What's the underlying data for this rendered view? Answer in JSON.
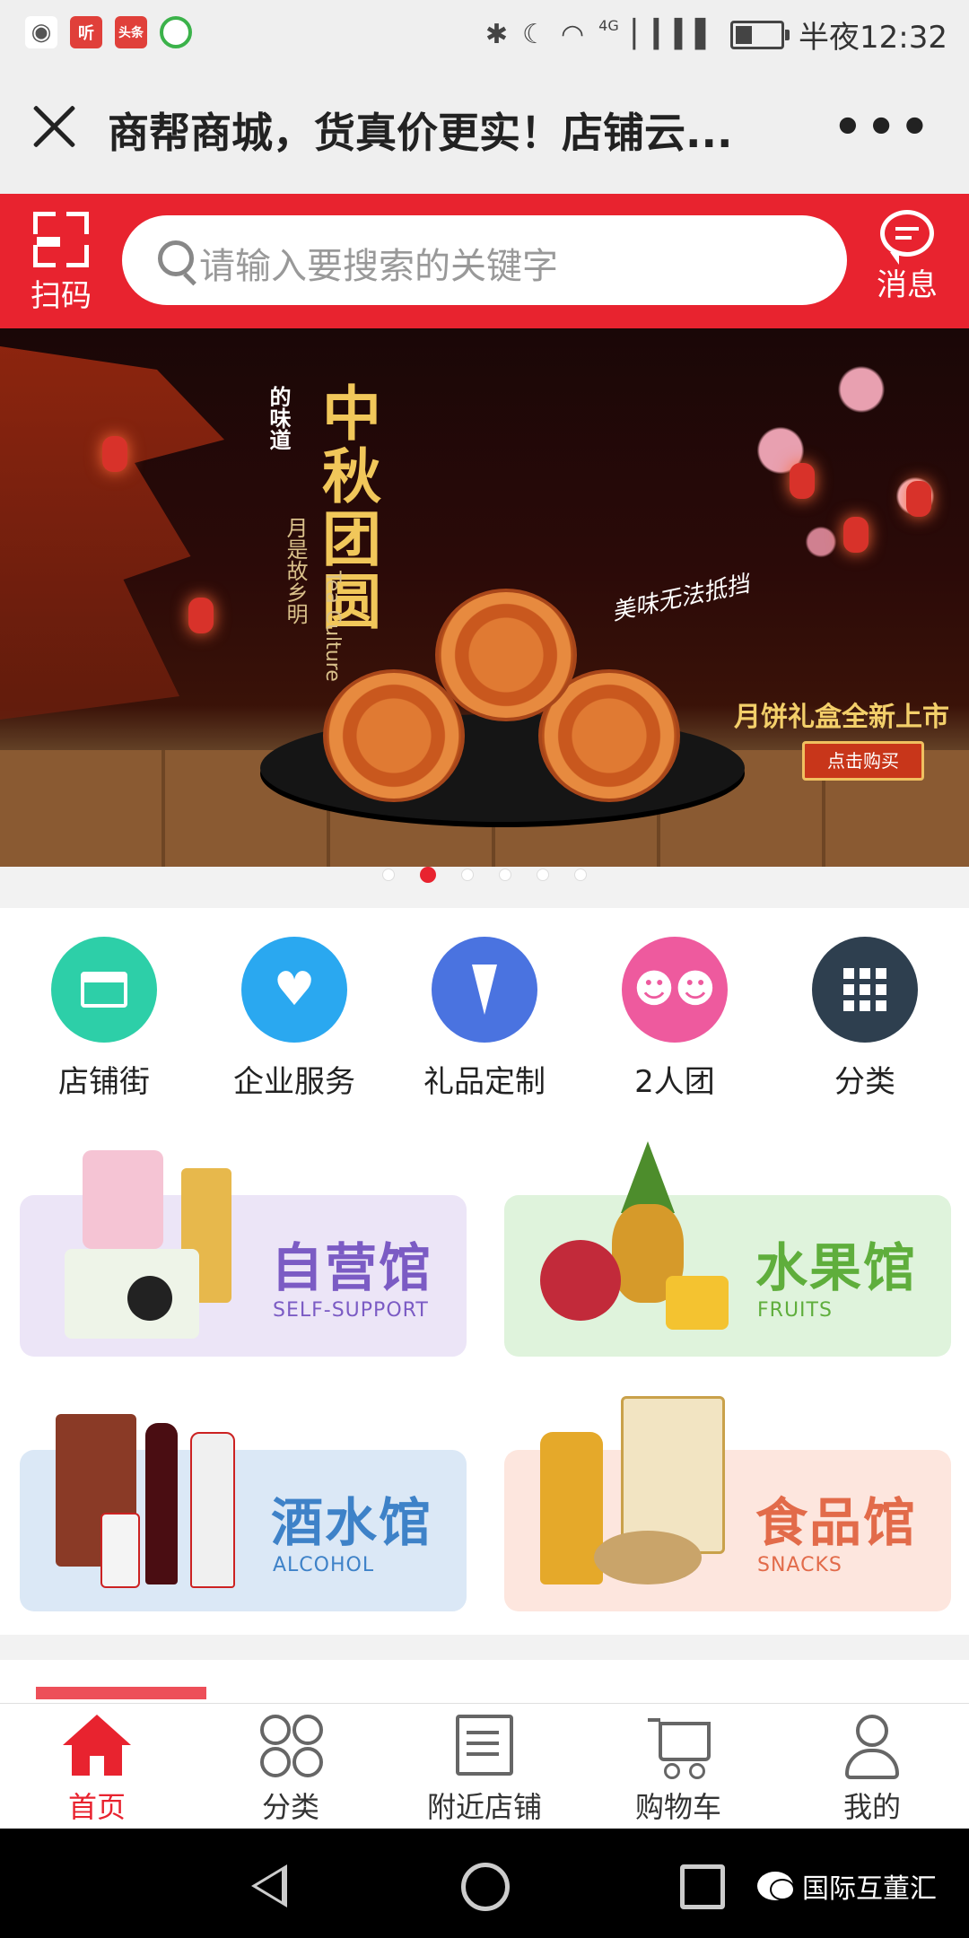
{
  "status_bar": {
    "time": "半夜12:32",
    "network": "4G",
    "notif_apps": [
      "听",
      "头条"
    ],
    "icons": [
      "wechat-icon",
      "ting-app-icon",
      "toutiao-app-icon",
      "browser-app-icon",
      "bluetooth-icon",
      "moon-icon",
      "wifi-icon",
      "signal-icon",
      "battery-icon"
    ]
  },
  "title_bar": {
    "title": "商帮商城，货真价更实！店铺云...",
    "more": "•••"
  },
  "header": {
    "scan_label": "扫码",
    "search_placeholder": "请输入要搜索的关键字",
    "message_label": "消息",
    "accent": "#e8232f"
  },
  "banner": {
    "tagline_small": "的味道",
    "title": "中秋团圆",
    "vertical_text": "月是故乡明",
    "english": "Tea Culture",
    "slogan": "美味无法抵挡",
    "new_release": "月饼礼盒全新上市",
    "buy_button": "点击购买",
    "slide_count": 6,
    "active_slide": 2
  },
  "quick_nav": [
    {
      "label": "店铺街",
      "color": "#2dcfa8",
      "icon": "store-icon"
    },
    {
      "label": "企业服务",
      "color": "#2aa8f0",
      "icon": "heart-icon"
    },
    {
      "label": "礼品定制",
      "color": "#4a73e0",
      "icon": "tie-icon"
    },
    {
      "label": "2人团",
      "color": "#ee5a9e",
      "icon": "group-icon"
    },
    {
      "label": "分类",
      "color": "#2e3f4f",
      "icon": "grid-icon"
    }
  ],
  "category_cards": [
    {
      "name": "自营馆",
      "en": "SELF-SUPPORT",
      "bg": "#ece5f7",
      "color": "#7b5bc4"
    },
    {
      "name": "水果馆",
      "en": "FRUITS",
      "bg": "#dff3dc",
      "color": "#5fae3c"
    },
    {
      "name": "酒水馆",
      "en": "ALCOHOL",
      "bg": "#dbe8f6",
      "color": "#3e82c8"
    },
    {
      "name": "食品馆",
      "en": "SNACKS",
      "bg": "#fde6de",
      "color": "#e26b4a"
    }
  ],
  "tab_bar": [
    {
      "label": "首页",
      "icon": "home-icon",
      "active": true
    },
    {
      "label": "分类",
      "icon": "category-icon",
      "active": false
    },
    {
      "label": "附近店铺",
      "icon": "nearby-store-icon",
      "active": false
    },
    {
      "label": "购物车",
      "icon": "cart-icon",
      "active": false
    },
    {
      "label": "我的",
      "icon": "profile-icon",
      "active": false
    }
  ],
  "watermark": "国际互董汇"
}
